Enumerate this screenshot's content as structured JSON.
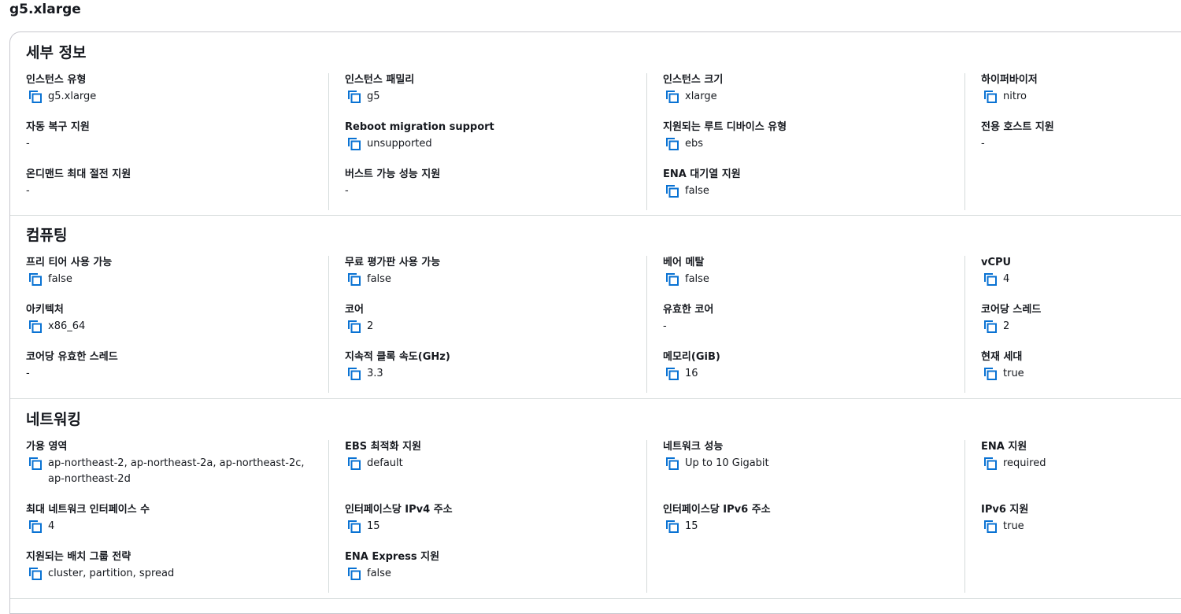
{
  "page": {
    "title": "g5.xlarge"
  },
  "sections": {
    "details": {
      "title": "세부 정보",
      "fields": [
        {
          "label": "인스턴스 유형",
          "value": "g5.xlarge",
          "copy": true
        },
        {
          "label": "인스턴스 패밀리",
          "value": "g5",
          "copy": true
        },
        {
          "label": "인스턴스 크기",
          "value": "xlarge",
          "copy": true
        },
        {
          "label": "하이퍼바이저",
          "value": "nitro",
          "copy": true
        },
        {
          "label": "자동 복구 지원",
          "value": "-",
          "copy": false
        },
        {
          "label": "Reboot migration support",
          "value": "unsupported",
          "copy": true
        },
        {
          "label": "지원되는 루트 디바이스 유형",
          "value": "ebs",
          "copy": true
        },
        {
          "label": "전용 호스트 지원",
          "value": "-",
          "copy": false
        },
        {
          "label": "온디맨드 최대 절전 지원",
          "value": "-",
          "copy": false
        },
        {
          "label": "버스트 가능 성능 지원",
          "value": "-",
          "copy": false
        },
        {
          "label": "ENA 대기열 지원",
          "value": "false",
          "copy": true
        }
      ]
    },
    "compute": {
      "title": "컴퓨팅",
      "fields": [
        {
          "label": "프리 티어 사용 가능",
          "value": "false",
          "copy": true
        },
        {
          "label": "무료 평가판 사용 가능",
          "value": "false",
          "copy": true
        },
        {
          "label": "베어 메탈",
          "value": "false",
          "copy": true
        },
        {
          "label": "vCPU",
          "value": "4",
          "copy": true
        },
        {
          "label": "아키텍처",
          "value": "x86_64",
          "copy": true
        },
        {
          "label": "코어",
          "value": "2",
          "copy": true
        },
        {
          "label": "유효한 코어",
          "value": "-",
          "copy": false
        },
        {
          "label": "코어당 스레드",
          "value": "2",
          "copy": true
        },
        {
          "label": "코어당 유효한 스레드",
          "value": "-",
          "copy": false
        },
        {
          "label": "지속적 클록 속도(GHz)",
          "value": "3.3",
          "copy": true
        },
        {
          "label": "메모리(GiB)",
          "value": "16",
          "copy": true
        },
        {
          "label": "현재 세대",
          "value": "true",
          "copy": true
        }
      ]
    },
    "networking": {
      "title": "네트워킹",
      "fields": [
        {
          "label": "가용 영역",
          "value": "ap-northeast-2, ap-northeast-2a, ap-northeast-2c, ap-northeast-2d",
          "copy": true
        },
        {
          "label": "EBS 최적화 지원",
          "value": "default",
          "copy": true
        },
        {
          "label": "네트워크 성능",
          "value": "Up to 10 Gigabit",
          "copy": true
        },
        {
          "label": "ENA 지원",
          "value": "required",
          "copy": true
        },
        {
          "label": "최대 네트워크 인터페이스 수",
          "value": "4",
          "copy": true
        },
        {
          "label": "인터페이스당 IPv4 주소",
          "value": "15",
          "copy": true
        },
        {
          "label": "인터페이스당 IPv6 주소",
          "value": "15",
          "copy": true
        },
        {
          "label": "IPv6 지원",
          "value": "true",
          "copy": true
        },
        {
          "label": "지원되는 배치 그룹 전략",
          "value": "cluster, partition, spread",
          "copy": true
        },
        {
          "label": "ENA Express 지원",
          "value": "false",
          "copy": true
        }
      ]
    }
  },
  "icons": {
    "copy": "copy-icon"
  },
  "colors": {
    "accent": "#0972d3",
    "divider": "#d5dbdb",
    "text": "#16191f"
  }
}
